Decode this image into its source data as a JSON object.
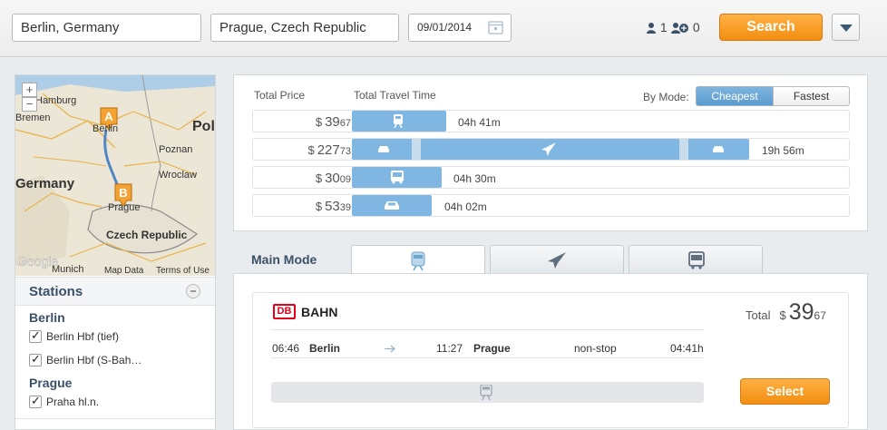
{
  "header": {
    "from_value": "Berlin, Germany",
    "to_value": "Prague, Czech Republic",
    "date_value": "09/01/2014",
    "adults": "1",
    "children": "0",
    "search_label": "Search"
  },
  "map": {
    "labels": [
      "Hamburg",
      "Bremen",
      "Berlin",
      "Pol",
      "Poznan",
      "Germany",
      "Wroclaw",
      "Prague",
      "Czech Republic",
      "Munich",
      "Google",
      "Map Data",
      "Terms of Use"
    ],
    "marker_a": "A",
    "marker_b": "B",
    "zoom_in": "+",
    "zoom_out": "−"
  },
  "stations": {
    "title": "Stations",
    "groups": [
      {
        "city": "Berlin",
        "items": [
          "Berlin Hbf (tief)",
          "Berlin Hbf (S-Bah…"
        ]
      },
      {
        "city": "Prague",
        "items": [
          "Praha hl.n."
        ]
      }
    ]
  },
  "summary": {
    "total_price_label": "Total Price",
    "travel_time_label": "Total Travel Time",
    "by_mode_label": "By Mode:",
    "cheapest_label": "Cheapest",
    "fastest_label": "Fastest",
    "rows": [
      {
        "currency": "$",
        "dollars": "39",
        "cents": "67",
        "duration": "04h 41m",
        "mode": "train"
      },
      {
        "currency": "$",
        "dollars": "227",
        "cents": "73",
        "duration": "19h 56m",
        "mode": "flight"
      },
      {
        "currency": "$",
        "dollars": "30",
        "cents": "09",
        "duration": "04h 30m",
        "mode": "bus"
      },
      {
        "currency": "$",
        "dollars": "53",
        "cents": "39",
        "duration": "04h 02m",
        "mode": "car"
      }
    ]
  },
  "main": {
    "main_mode_label": "Main Mode",
    "tabs": [
      "train-icon",
      "plane-icon",
      "bus-icon"
    ],
    "result": {
      "logo_text": "DB",
      "operator": "BAHN",
      "total_label": "Total",
      "currency": "$",
      "dollars": "39",
      "cents": "67",
      "depart_time": "06:46",
      "depart_city": "Berlin",
      "arrive_time": "11:27",
      "arrive_city": "Prague",
      "stops": "non-stop",
      "duration": "04:41h",
      "select_label": "Select"
    }
  },
  "colors": {
    "accent_orange": "#f28e12",
    "bar_blue": "#7fb7e2",
    "heading": "#3b5068"
  }
}
